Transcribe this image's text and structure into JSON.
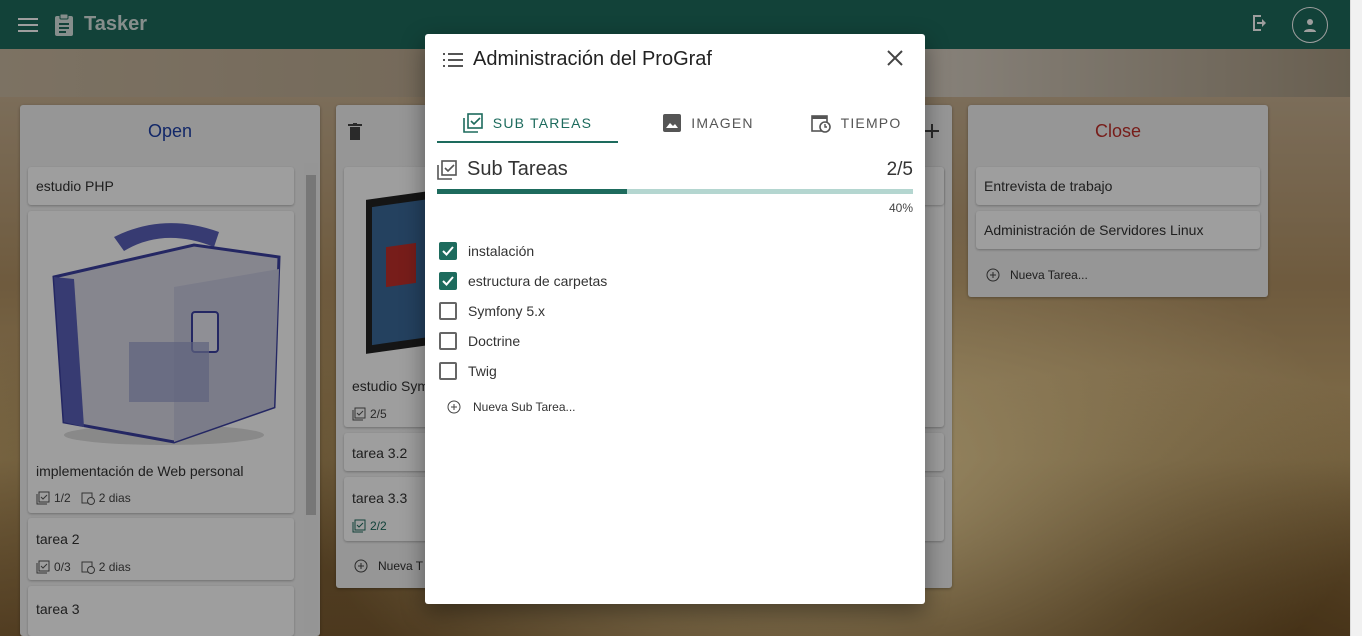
{
  "app": {
    "title": "Tasker"
  },
  "columns": {
    "open": {
      "title": "Open",
      "title_color": "#1e40a8",
      "cards": [
        {
          "title": "estudio PHP"
        },
        {
          "title": "implementación de Web personal",
          "subtasks": "1/2",
          "time": "2 dias"
        },
        {
          "title": "tarea 2",
          "subtasks": "0/3",
          "time": "2 dias"
        },
        {
          "title": "tarea 3"
        }
      ]
    },
    "second": {
      "cards": [
        {
          "title": "estudio Sym",
          "subtasks": "2/5"
        },
        {
          "title": "tarea 3.2"
        },
        {
          "title": "tarea 3.3",
          "subtasks": "2/2"
        }
      ],
      "new_task": "Nueva T"
    },
    "close": {
      "title": "Close",
      "title_color": "#c0302a",
      "cards": [
        {
          "title": "Entrevista de trabajo"
        },
        {
          "title": "Administración de Servidores Linux"
        }
      ],
      "new_task": "Nueva Tarea..."
    }
  },
  "dialog": {
    "title": "Administración del ProGraf",
    "tabs": [
      {
        "label": "SUB TAREAS",
        "icon": "checklist-icon",
        "active": true
      },
      {
        "label": "IMAGEN",
        "icon": "image-icon",
        "active": false
      },
      {
        "label": "TIEMPO",
        "icon": "calendar-clock-icon",
        "active": false
      }
    ],
    "section_title": "Sub Tareas",
    "count": "2/5",
    "progress_percent": 40,
    "progress_label": "40%",
    "subtasks": [
      {
        "label": "instalación",
        "checked": true
      },
      {
        "label": "estructura de carpetas",
        "checked": true
      },
      {
        "label": "Symfony 5.x",
        "checked": false
      },
      {
        "label": "Doctrine",
        "checked": false
      },
      {
        "label": "Twig",
        "checked": false
      }
    ],
    "add_subtask": "Nueva Sub Tarea...",
    "accent_color": "#1d6b5d"
  }
}
